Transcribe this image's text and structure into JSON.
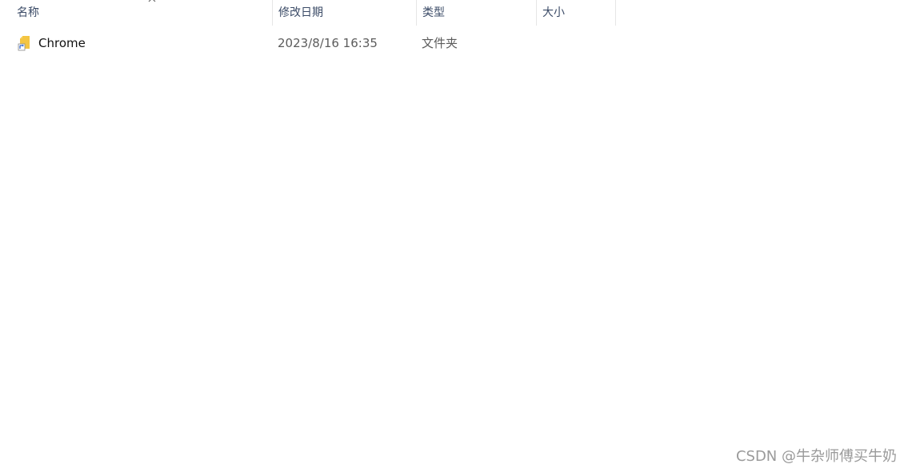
{
  "columns": {
    "name": "名称",
    "date": "修改日期",
    "type": "类型",
    "size": "大小"
  },
  "sort": {
    "column": "name",
    "direction": "ascending",
    "icon": "chevron-up-icon"
  },
  "rows": [
    {
      "name": "Chrome",
      "date": "2023/8/16 16:35",
      "type": "文件夹",
      "size": "",
      "icon": "folder-shortcut-icon"
    }
  ],
  "watermark": "CSDN @牛杂师傅买牛奶",
  "colors": {
    "header_text": "#3a4a66",
    "folder": "#f4c542",
    "shortcut_arrow": "#2a62c9",
    "meta_text": "#5c5c5c"
  }
}
